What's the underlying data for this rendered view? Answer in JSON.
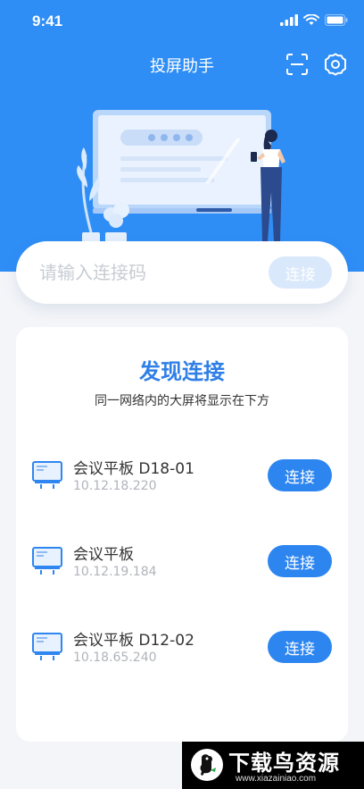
{
  "status_bar": {
    "time": "9:41"
  },
  "header": {
    "title": "投屏助手"
  },
  "icons": {
    "scan": "scan-icon",
    "settings": "gear-icon"
  },
  "code_bar": {
    "placeholder": "请输入连接码",
    "connect_label": "连接"
  },
  "discover": {
    "title": "发现连接",
    "subtitle": "同一网络内的大屏将显示在下方",
    "devices": [
      {
        "name": "会议平板 D18-01",
        "ip": "10.12.18.220",
        "action": "连接"
      },
      {
        "name": "会议平板",
        "ip": "10.12.19.184",
        "action": "连接"
      },
      {
        "name": "会议平板 D12-02",
        "ip": "10.18.65.240",
        "action": "连接"
      }
    ]
  },
  "watermark": {
    "brand": "下载鸟资源",
    "url": "www.xiazainiao.com"
  },
  "colors": {
    "primary": "#2f8ef6",
    "button": "#2d86f0",
    "disabled_button": "#d9e8fb",
    "background": "#f3f5f8"
  }
}
